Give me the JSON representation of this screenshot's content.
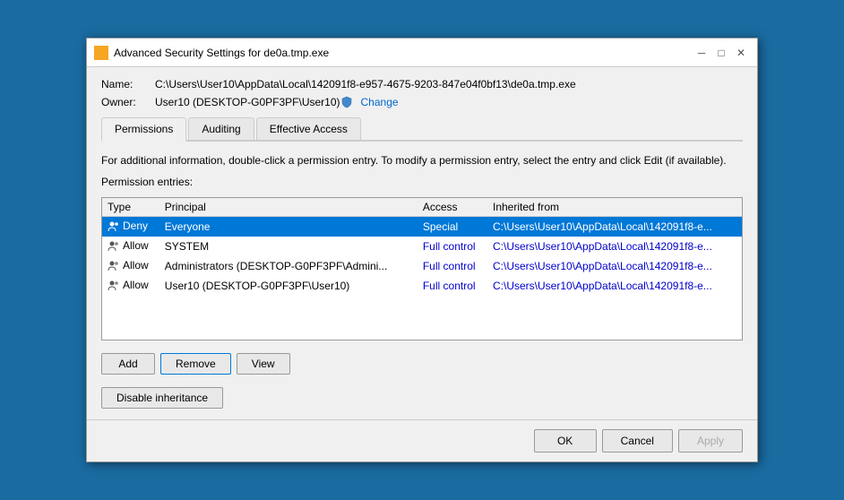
{
  "window": {
    "title": "Advanced Security Settings for de0a.tmp.exe",
    "icon": "folder-icon"
  },
  "titlebar": {
    "minimize_label": "─",
    "maximize_label": "□",
    "close_label": "✕"
  },
  "info": {
    "name_label": "Name:",
    "name_value": "C:\\Users\\User10\\AppData\\Local\\142091f8-e957-4675-9203-847e04f0bf13\\de0a.tmp.exe",
    "owner_label": "Owner:",
    "owner_value": "User10 (DESKTOP-G0PF3PF\\User10)",
    "change_label": "Change"
  },
  "tabs": [
    {
      "label": "Permissions",
      "active": true
    },
    {
      "label": "Auditing",
      "active": false
    },
    {
      "label": "Effective Access",
      "active": false
    }
  ],
  "description": "For additional information, double-click a permission entry. To modify a permission entry, select the entry and click Edit (if available).",
  "perm_entries_label": "Permission entries:",
  "table": {
    "columns": [
      "Type",
      "Principal",
      "Access",
      "Inherited from"
    ],
    "rows": [
      {
        "type": "Deny",
        "principal": "Everyone",
        "access": "Special",
        "inherited": "C:\\Users\\User10\\AppData\\Local\\142091f8-e...",
        "selected": true
      },
      {
        "type": "Allow",
        "principal": "SYSTEM",
        "access": "Full control",
        "inherited": "C:\\Users\\User10\\AppData\\Local\\142091f8-e...",
        "selected": false
      },
      {
        "type": "Allow",
        "principal": "Administrators (DESKTOP-G0PF3PF\\Admini...",
        "access": "Full control",
        "inherited": "C:\\Users\\User10\\AppData\\Local\\142091f8-e...",
        "selected": false
      },
      {
        "type": "Allow",
        "principal": "User10 (DESKTOP-G0PF3PF\\User10)",
        "access": "Full control",
        "inherited": "C:\\Users\\User10\\AppData\\Local\\142091f8-e...",
        "selected": false
      }
    ]
  },
  "buttons": {
    "add_label": "Add",
    "remove_label": "Remove",
    "view_label": "View",
    "disable_inheritance_label": "Disable inheritance"
  },
  "footer_buttons": {
    "ok_label": "OK",
    "cancel_label": "Cancel",
    "apply_label": "Apply"
  }
}
